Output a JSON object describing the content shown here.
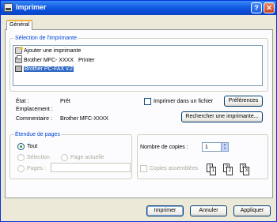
{
  "window": {
    "title": "Imprimer",
    "help_glyph": "?",
    "close_glyph": "✕"
  },
  "tabs": [
    {
      "label": "Général",
      "active": true
    }
  ],
  "printer_selection": {
    "group_label": "Sélection de l'imprimante",
    "printers": [
      {
        "name": "Ajouter une imprimante",
        "icon": "add-printer-icon"
      },
      {
        "name": "Brother MFC- XXXX",
        "extra": "Printer",
        "icon": "printer-icon"
      },
      {
        "name": "Brother PC-FAX v.2",
        "icon": "fax-icon",
        "selected": true
      }
    ],
    "status_label": "État :",
    "status_value": "Prêt",
    "location_label": "Emplacement :",
    "comment_label": "Commentaire :",
    "comment_value": "Brother MFC-XXXX",
    "print_to_file_label": "Imprimer dans un fichier",
    "print_to_file_checked": false,
    "preferences_label": "Préférences",
    "find_printer_label": "Rechercher une imprimante..."
  },
  "page_range": {
    "group_label": "Étendue de pages",
    "all_label": "Tout",
    "selection_label": "Sélection",
    "current_page_label": "Page actuelle",
    "pages_label": "Pages :",
    "pages_value": "",
    "selected": "all"
  },
  "copies": {
    "count_label": "Nombre de copies :",
    "count_value": "1",
    "collate_label": "Copies assemblées",
    "collate_checked": false,
    "page_numbers": [
      "1",
      "1",
      "2",
      "2",
      "3",
      "3"
    ]
  },
  "footer": {
    "print_label": "Imprimer",
    "cancel_label": "Annuler",
    "apply_label": "Appliquer"
  },
  "colors": {
    "title_bar": "#0a4ed8",
    "group_label": "#0046d5",
    "selection": "#316ac5",
    "radio_dot": "#21a121"
  }
}
